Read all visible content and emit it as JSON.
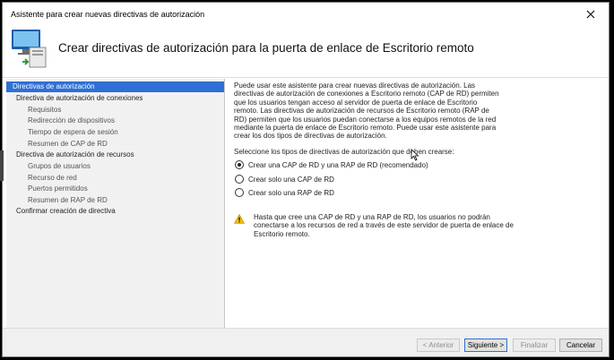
{
  "window": {
    "title": "Asistente para crear nuevas directivas de autorización"
  },
  "header": {
    "title": "Crear directivas de autorización para la puerta de enlace de Escritorio remoto"
  },
  "nav": {
    "items": [
      {
        "label": "Directivas de autorización",
        "level": 0,
        "selected": true
      },
      {
        "label": "Directiva de autorización de conexiones",
        "level": 0
      },
      {
        "label": "Requisitos",
        "level": 1
      },
      {
        "label": "Redirección de dispositivos",
        "level": 1
      },
      {
        "label": "Tiempo de espera de sesión",
        "level": 1
      },
      {
        "label": "Resumen de CAP de RD",
        "level": 1
      },
      {
        "label": "Directiva de autorización de recursos",
        "level": 0
      },
      {
        "label": "Grupos de usuarios",
        "level": 1
      },
      {
        "label": "Recurso de red",
        "level": 1
      },
      {
        "label": "Puertos permitidos",
        "level": 1
      },
      {
        "label": "Resumen de RAP de RD",
        "level": 1
      },
      {
        "label": "Confirmar creación de directiva",
        "level": 0
      }
    ]
  },
  "content": {
    "intro": "Puede usar este asistente para crear nuevas directivas de autorización. Las directivas de autorización de conexiones a Escritorio remoto (CAP de RD) permiten que los usuarios tengan acceso al servidor de puerta de enlace de Escritorio remoto. Las directivas de autorización de recursos de Escritorio remoto (RAP de RD) permiten que los usuarios puedan conectarse a los equipos remotos de la red mediante la puerta de enlace de Escritorio remoto. Puede usar este asistente para crear los dos tipos de directivas de autorización.",
    "question": "Seleccione los tipos de directivas de autorización que deben crearse:",
    "options": [
      {
        "label": "Crear una CAP de RD y una RAP de RD (recomendado)",
        "checked": true
      },
      {
        "label": "Crear solo una CAP de RD",
        "checked": false
      },
      {
        "label": "Crear solo una RAP de RD",
        "checked": false
      }
    ],
    "warning": "Hasta que cree una CAP de RD y una RAP de RD, los usuarios no podrán conectarse a los recursos de red a través de este servidor de puerta de enlace de Escritorio remoto."
  },
  "footer": {
    "back": "< Anterior",
    "next": "Siguiente >",
    "finish": "Finalizar",
    "cancel": "Cancelar"
  },
  "colors": {
    "selection": "#2f6fd6",
    "warning": "#f2c200"
  },
  "icons": {
    "close": "close-icon",
    "wizard": "computer-network-icon",
    "warning": "warning-icon",
    "cursor": "mouse-cursor-icon"
  }
}
